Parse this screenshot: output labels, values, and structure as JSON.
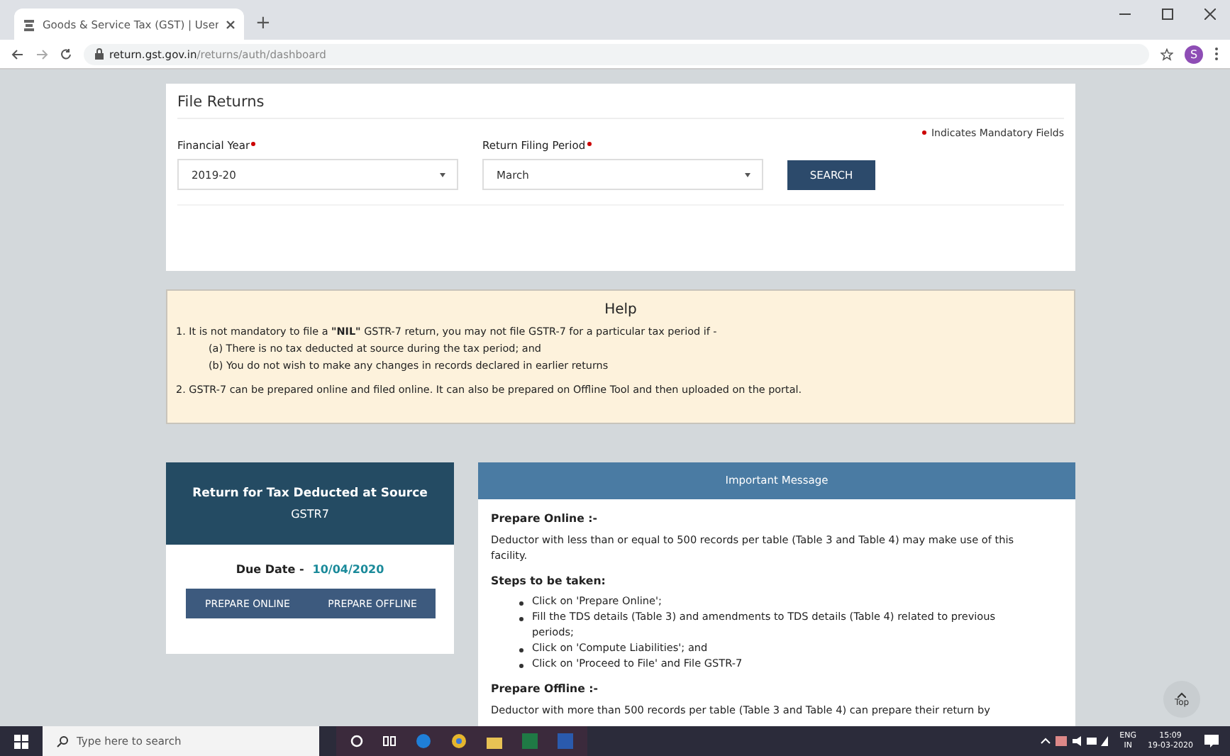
{
  "browser": {
    "tab_title": "Goods & Service Tax (GST) | User",
    "new_tab": "+",
    "url_host": "return.gst.gov.in",
    "url_path": "/returns/auth/dashboard",
    "avatar": "S"
  },
  "file_returns": {
    "title": "File Returns",
    "mandatory_note": "Indicates Mandatory Fields",
    "fields": [
      {
        "label": "Financial Year",
        "value": "2019-20"
      },
      {
        "label": "Return Filing Period",
        "value": "March"
      }
    ],
    "search_button": "SEARCH"
  },
  "help": {
    "title": "Help",
    "items": [
      {
        "kind": "item",
        "text": "1. It is not mandatory to file a **\"NIL\"** GSTR-7 return, you may not file GSTR-7 for a particular tax period if -"
      },
      {
        "kind": "sub",
        "text": "(a) There is no tax deducted at source during the tax period; and"
      },
      {
        "kind": "sub",
        "text": "(b) You do not wish to make any changes in records declared in earlier returns"
      },
      {
        "kind": "item",
        "text": "2. GSTR-7 can be prepared online and filed online. It can also be prepared on Offline Tool and then uploaded on the portal."
      }
    ]
  },
  "return_card": {
    "title": "Return for Tax Deducted at Source",
    "subtitle": "GSTR7",
    "due_label": "Due Date -",
    "due_date": "10/04/2020",
    "buttons": [
      "PREPARE ONLINE",
      "PREPARE OFFLINE"
    ]
  },
  "important_message": {
    "title": "Important Message",
    "blocks": [
      {
        "kind": "heading",
        "text": "Prepare Online :-"
      },
      {
        "kind": "para",
        "text": "Deductor with less than or equal to 500 records per table (Table 3 and Table 4) may make use of this facility."
      },
      {
        "kind": "heading",
        "text": "Steps to be taken:"
      },
      {
        "kind": "list",
        "items": [
          "Click on 'Prepare Online';",
          "Fill the TDS details (Table 3) and amendments to TDS details (Table 4) related to previous periods;",
          "Click on 'Compute Liabilities'; and",
          "Click on 'Proceed to File' and File GSTR-7"
        ]
      },
      {
        "kind": "heading",
        "text": "Prepare Offline :-"
      },
      {
        "kind": "para",
        "text": "Deductor with more than 500 records per table (Table 3 and Table 4) can prepare their return by"
      }
    ]
  },
  "top_button": "Top",
  "taskbar": {
    "search_placeholder": "Type here to search",
    "language": "ENG",
    "region": "IN",
    "time": "15:09",
    "date": "19-03-2020"
  }
}
